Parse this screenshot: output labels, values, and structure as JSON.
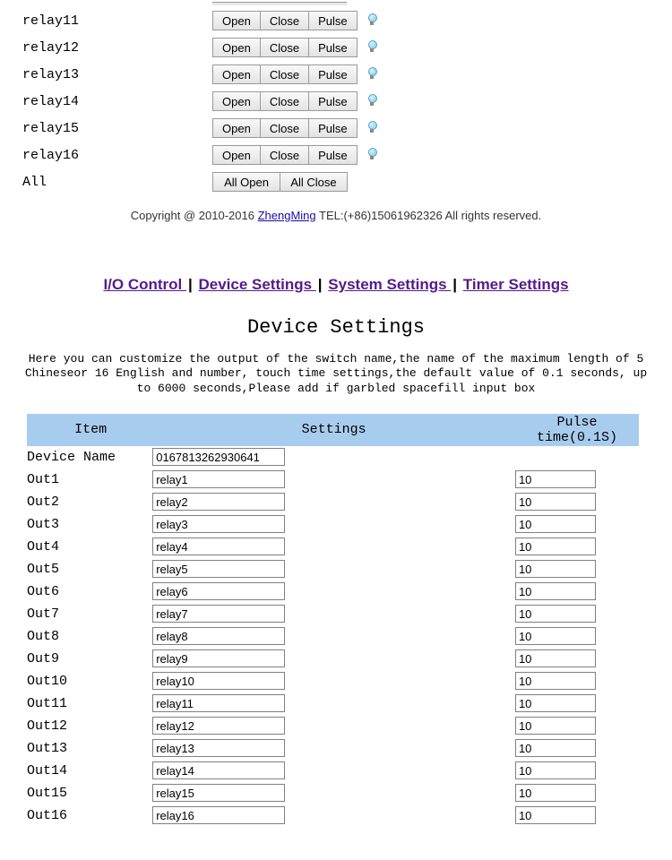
{
  "relays": [
    {
      "label": "relay11",
      "open": "Open",
      "close": "Close",
      "pulse": "Pulse"
    },
    {
      "label": "relay12",
      "open": "Open",
      "close": "Close",
      "pulse": "Pulse"
    },
    {
      "label": "relay13",
      "open": "Open",
      "close": "Close",
      "pulse": "Pulse"
    },
    {
      "label": "relay14",
      "open": "Open",
      "close": "Close",
      "pulse": "Pulse"
    },
    {
      "label": "relay15",
      "open": "Open",
      "close": "Close",
      "pulse": "Pulse"
    },
    {
      "label": "relay16",
      "open": "Open",
      "close": "Close",
      "pulse": "Pulse"
    }
  ],
  "all": {
    "label": "All",
    "open": "All Open",
    "close": "All Close"
  },
  "copyright": {
    "pre": "Copyright @ 2010-2016 ",
    "link": "ZhengMing",
    "post": " TEL:(+86)15061962326 All rights reserved."
  },
  "nav": {
    "io": "I/O Control ",
    "device": "Device Settings ",
    "system": "System Settings ",
    "timer": "Timer Settings",
    "sep": "| "
  },
  "title": "Device Settings",
  "desc": "Here you can customize the output of the switch name,the name of the maximum length of 5 Chineseor 16 English and number, touch time settings,the default value of 0.1 seconds, up to 6000 seconds,Please add if garbled spacefill input box",
  "headers": {
    "item": "Item",
    "settings": "Settings",
    "pulse": "Pulse time(0.1S)"
  },
  "device_name": {
    "label": "Device Name",
    "value": "0167813262930641"
  },
  "outs": [
    {
      "label": "Out1",
      "name": "relay1",
      "pulse": "10"
    },
    {
      "label": "Out2",
      "name": "relay2",
      "pulse": "10"
    },
    {
      "label": "Out3",
      "name": "relay3",
      "pulse": "10"
    },
    {
      "label": "Out4",
      "name": "relay4",
      "pulse": "10"
    },
    {
      "label": "Out5",
      "name": "relay5",
      "pulse": "10"
    },
    {
      "label": "Out6",
      "name": "relay6",
      "pulse": "10"
    },
    {
      "label": "Out7",
      "name": "relay7",
      "pulse": "10"
    },
    {
      "label": "Out8",
      "name": "relay8",
      "pulse": "10"
    },
    {
      "label": "Out9",
      "name": "relay9",
      "pulse": "10"
    },
    {
      "label": "Out10",
      "name": "relay10",
      "pulse": "10"
    },
    {
      "label": "Out11",
      "name": "relay11",
      "pulse": "10"
    },
    {
      "label": "Out12",
      "name": "relay12",
      "pulse": "10"
    },
    {
      "label": "Out13",
      "name": "relay13",
      "pulse": "10"
    },
    {
      "label": "Out14",
      "name": "relay14",
      "pulse": "10"
    },
    {
      "label": "Out15",
      "name": "relay15",
      "pulse": "10"
    },
    {
      "label": "Out16",
      "name": "relay16",
      "pulse": "10"
    }
  ]
}
